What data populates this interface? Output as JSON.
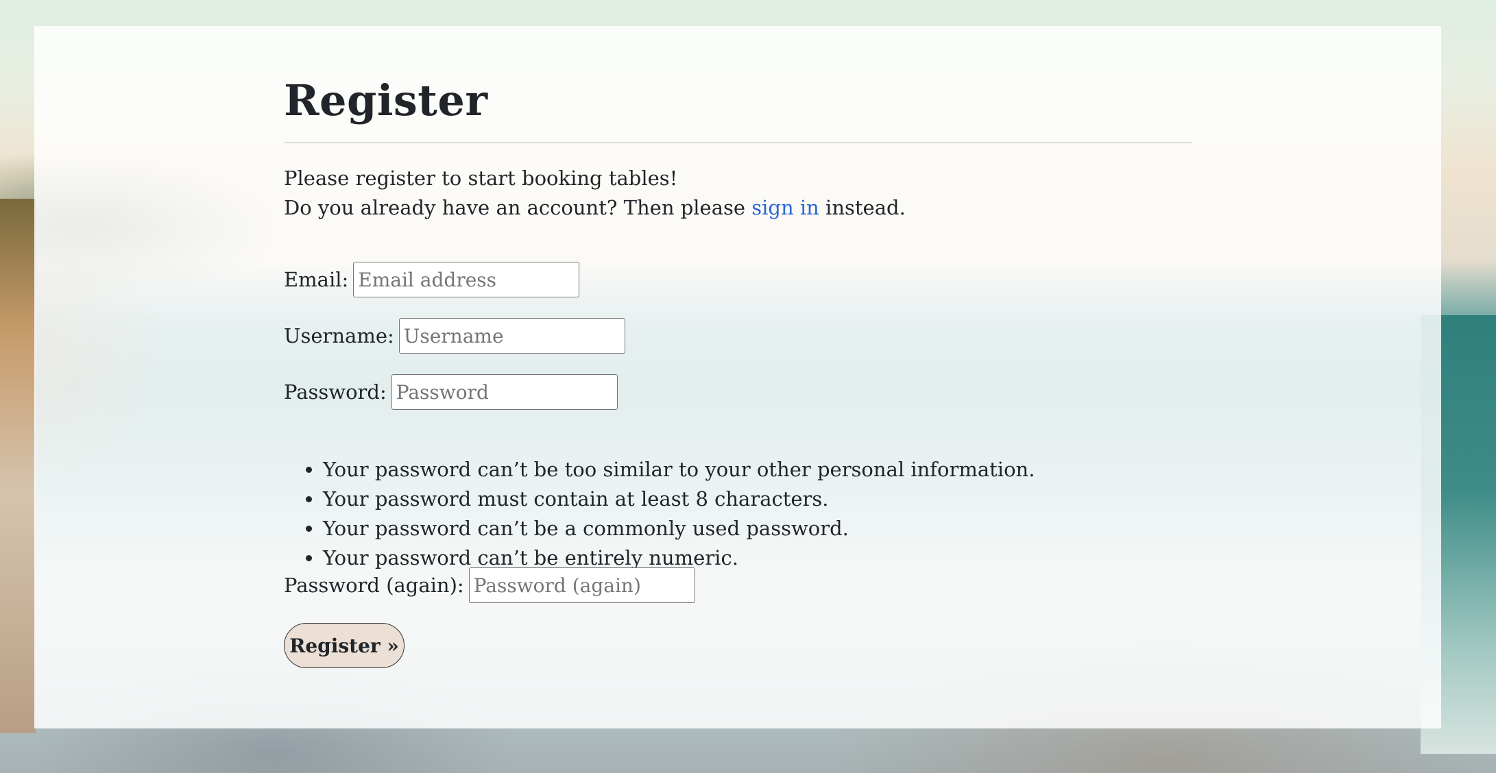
{
  "page": {
    "title": "Register",
    "intro_line1": "Please register to start booking tables!",
    "intro_line2_prefix": "Do you already have an account? Then please ",
    "intro_link": "sign in",
    "intro_line2_suffix": " instead."
  },
  "form": {
    "email": {
      "label": "Email:",
      "placeholder": "Email address",
      "value": ""
    },
    "username": {
      "label": "Username:",
      "placeholder": "Username",
      "value": ""
    },
    "password": {
      "label": "Password:",
      "placeholder": "Password",
      "value": ""
    },
    "password_help": [
      "Your password can’t be too similar to your other personal information.",
      "Your password must contain at least 8 characters.",
      "Your password can’t be a commonly used password.",
      "Your password can’t be entirely numeric."
    ],
    "password_again": {
      "label": "Password (again):",
      "placeholder": "Password (again)",
      "value": ""
    },
    "submit_label": "Register »"
  },
  "colors": {
    "link": "#2a64d6",
    "button_bg": "#ebdfd6",
    "text": "#212529"
  }
}
